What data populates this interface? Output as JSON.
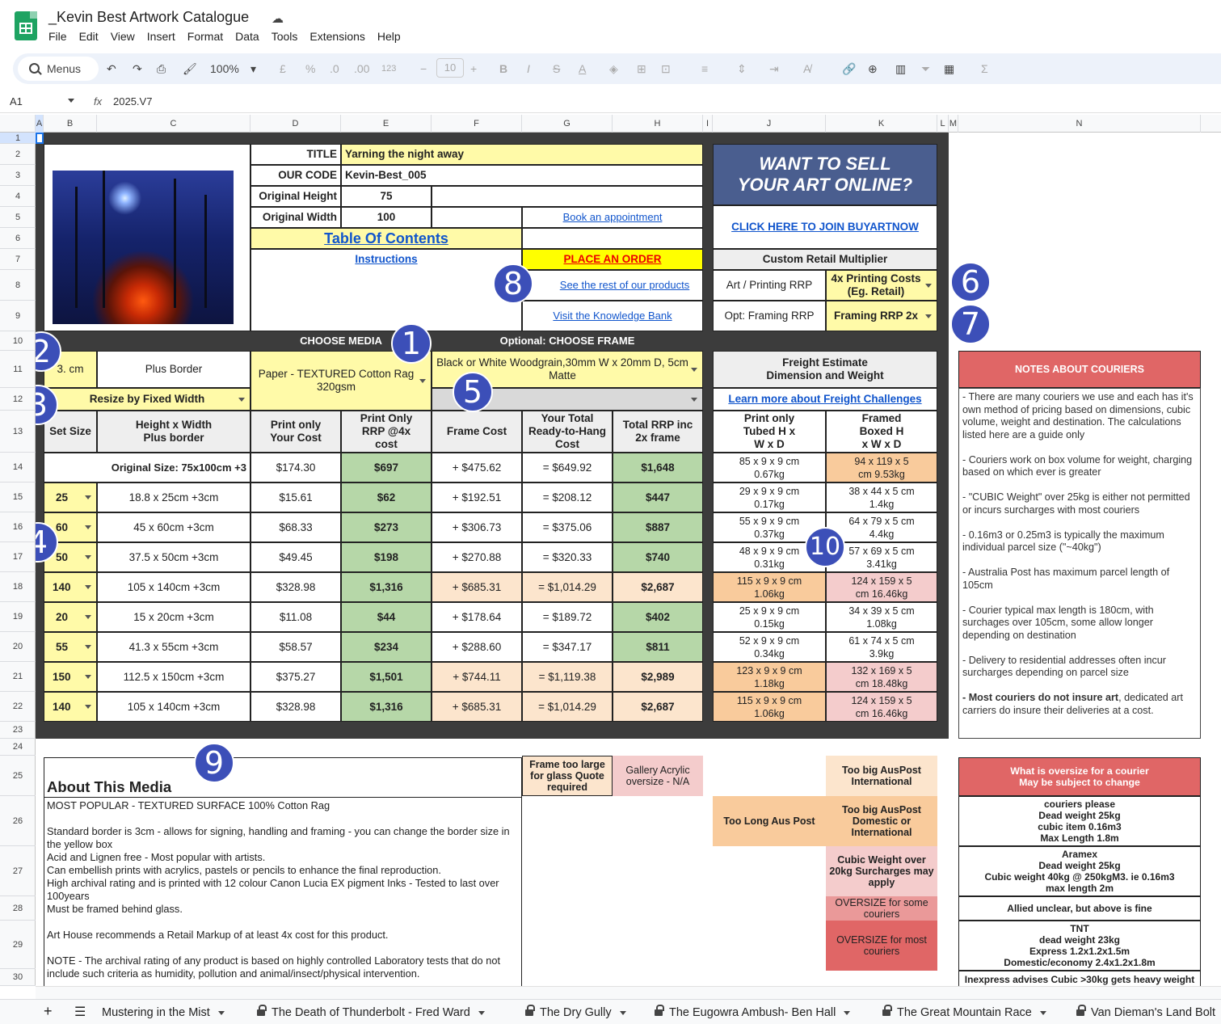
{
  "app": {
    "title": "_Kevin Best Artwork Catalogue",
    "menu": [
      "File",
      "Edit",
      "View",
      "Insert",
      "Format",
      "Data",
      "Tools",
      "Extensions",
      "Help"
    ],
    "icon": "google-sheets-icon"
  },
  "toolbar": {
    "menus": "Menus",
    "zoom": "100%",
    "pound": "£",
    "percent": "%",
    "dec_minus": ".0",
    "dec_plus": ".00",
    "num_format": "123",
    "font_size": "10"
  },
  "formula": {
    "cell": "A1",
    "fx": "fx",
    "value": "2025.V7"
  },
  "columns": [
    "A",
    "B",
    "C",
    "D",
    "E",
    "F",
    "G",
    "H",
    "I",
    "J",
    "K",
    "L",
    "M",
    "N"
  ],
  "rows": [
    "1",
    "2",
    "3",
    "4",
    "5",
    "6",
    "7",
    "8",
    "9",
    "10",
    "11",
    "12",
    "13",
    "14",
    "15",
    "16",
    "17",
    "18",
    "19",
    "20",
    "21",
    "22",
    "23",
    "24",
    "25",
    "26",
    "27",
    "28",
    "29",
    "30"
  ],
  "info": {
    "title_label": "TITLE",
    "title_value": "Yarning the night away",
    "code_label": "OUR CODE",
    "code_value": "Kevin-Best_005",
    "height_label": "Original Height",
    "height_value": "75",
    "width_label": "Original Width",
    "width_value": "100",
    "toc": "Table Of Contents",
    "instructions": "Instructions",
    "book": "Book an appointment",
    "order": "PLACE AN ORDER",
    "products": "See the rest of our products",
    "knowledge": "Visit the Knowledge Bank"
  },
  "promo": {
    "heading_1": "WANT TO SELL",
    "heading_2": "YOUR ART ONLINE?",
    "link": "CLICK HERE TO JOIN BUYARTNOW"
  },
  "multiplier": {
    "header": "Custom Retail Multiplier",
    "art_label": "Art / Printing RRP",
    "art_value": "4x Printing Costs (Eg. Retail)",
    "frame_label": "Opt: Framing RRP",
    "frame_value": "Framing RRP 2x"
  },
  "section": {
    "media": "CHOOSE MEDIA",
    "frame": "Optional: CHOOSE FRAME"
  },
  "options": {
    "border_value": "3. cm",
    "border_label": "Plus Border",
    "resize": "Resize by Fixed Width",
    "media": "Paper - TEXTURED Cotton Rag 320gsm",
    "frame": "Black or White Woodgrain,30mm W x 20mm D, 5cm Matte"
  },
  "freight": {
    "header": "Freight Estimate Dimension and Weight",
    "link": "Learn more about Freight Challenges",
    "tubed_header": "Print only Tubed H x W x D",
    "boxed_header": "Framed Boxed H x W x D"
  },
  "table_headers": {
    "set_size": "Set Size",
    "hw": "Height x Width Plus border",
    "print_cost": "Print only Your Cost",
    "print_rrp": "Print Only RRP @4x cost",
    "frame_cost": "Frame Cost",
    "total_cost": "Your Total Ready-to-Hang Cost",
    "total_rrp": "Total RRP inc 2x frame"
  },
  "original_row": {
    "label": "Original Size: 75x100cm +3",
    "print_cost": "$174.30",
    "print_rrp": "$697",
    "frame_cost": "+  $475.62",
    "total_cost": "=  $649.92",
    "total_rrp": "$1,648",
    "tubed": "85 x 9 x 9 cm 0.67kg",
    "boxed": "94 x 119 x 5 cm 9.53kg"
  },
  "size_rows": [
    {
      "set": "25",
      "hw": "18.8 x 25cm +3cm",
      "pc": "$15.61",
      "rrp": "$62",
      "fc": "+  $192.51",
      "tc": "=  $208.12",
      "trrp": "$447",
      "tubed": "29 x 9 x 9 cm 0.17kg",
      "boxed": "38 x 44 x 5 cm 1.4kg"
    },
    {
      "set": "60",
      "hw": "45 x 60cm +3cm",
      "pc": "$68.33",
      "rrp": "$273",
      "fc": "+  $306.73",
      "tc": "=  $375.06",
      "trrp": "$887",
      "tubed": "55 x 9 x 9 cm 0.37kg",
      "boxed": "64 x 79 x 5 cm 4.4kg"
    },
    {
      "set": "50",
      "hw": "37.5 x 50cm +3cm",
      "pc": "$49.45",
      "rrp": "$198",
      "fc": "+  $270.88",
      "tc": "=  $320.33",
      "trrp": "$740",
      "tubed": "48 x 9 x 9 cm 0.31kg",
      "boxed": "57 x 69 x 5 cm 3.41kg"
    },
    {
      "set": "140",
      "hw": "105 x 140cm +3cm",
      "pc": "$328.98",
      "rrp": "$1,316",
      "fc": "+  $685.31",
      "tc": "=  $1,014.29",
      "trrp": "$2,687",
      "tubed": "115 x 9 x 9 cm 1.06kg",
      "boxed": "124 x 159 x 5 cm 16.46kg"
    },
    {
      "set": "20",
      "hw": "15 x 20cm +3cm",
      "pc": "$11.08",
      "rrp": "$44",
      "fc": "+  $178.64",
      "tc": "=  $189.72",
      "trrp": "$402",
      "tubed": "25 x 9 x 9 cm 0.15kg",
      "boxed": "34 x 39 x 5 cm 1.08kg"
    },
    {
      "set": "55",
      "hw": "41.3 x 55cm +3cm",
      "pc": "$58.57",
      "rrp": "$234",
      "fc": "+  $288.60",
      "tc": "=  $347.17",
      "trrp": "$811",
      "tubed": "52 x 9 x 9 cm 0.34kg",
      "boxed": "61 x 74 x 5 cm 3.9kg"
    },
    {
      "set": "150",
      "hw": "112.5 x 150cm +3cm",
      "pc": "$375.27",
      "rrp": "$1,501",
      "fc": "+  $744.11",
      "tc": "=  $1,119.38",
      "trrp": "$2,989",
      "tubed": "123 x 9 x 9 cm 1.18kg",
      "boxed": "132 x 169 x 5 cm 18.48kg"
    },
    {
      "set": "140",
      "hw": "105 x 140cm +3cm",
      "pc": "$328.98",
      "rrp": "$1,316",
      "fc": "+  $685.31",
      "tc": "=  $1,014.29",
      "trrp": "$2,687",
      "tubed": "115 x 9 x 9 cm 1.06kg",
      "boxed": "124 x 159 x 5 cm 16.46kg"
    }
  ],
  "couriers": {
    "header": "NOTES ABOUT COURIERS",
    "notes": [
      "- There are many couriers we use and each has it's own method of pricing based on dimensions, cubic volume, weight and destination. The calculations listed here are a guide only",
      "- Couriers work on box volume for weight, charging based on which ever is greater",
      "- \"CUBIC Weight\" over 25kg is either not permitted or incurs surcharges with most couriers",
      "- 0.16m3 or 0.25m3 is typically the maximum individual parcel size (\"~40kg\")",
      "- Australia Post has maximum parcel length of 105cm",
      "- Courier typical max length is 180cm, with surchages over 105cm, some allow longer depending on destination",
      "- Delivery to residential addresses often incur surcharges depending on parcel size"
    ],
    "last_bold": "- Most couriers do not insure art",
    "last_rest": ", dedicated art carriers do insure their deliveries at a cost."
  },
  "legend": {
    "frame_large": "Frame too large for glass Quote required",
    "acrylic": "Gallery Acrylic oversize - N/A",
    "too_long": "Too Long Aus Post",
    "too_big_intl": "Too big AusPost International",
    "too_big_dom": "Too big AusPost Domestic or International",
    "cubic": "Cubic Weight over 20kg Surcharges may apply",
    "oversize_some": "OVERSIZE for some couriers",
    "oversize_most": "OVERSIZE for most couriers"
  },
  "about": {
    "heading": "About This Media",
    "lines": [
      "MOST POPULAR - TEXTURED SURFACE 100% Cotton Rag",
      "",
      "Standard border is 3cm - allows for signing, handling and framing - you can change the border size in the yellow box",
      "Acid and Lignen free - Most popular with artists.",
      "Can embellish prints with acrylics, pastels or pencils to enhance the final reproduction.",
      "High archival rating and is printed with 12 colour Canon Lucia EX pigment Inks - Tested to last over 100years",
      "Must be framed behind glass.",
      "",
      "Art House recommends a Retail Markup of at least 4x cost for this product.",
      "",
      "NOTE - The archival rating of any product is based on highly controlled Laboratory tests that do not include such criteria as humidity, pollution and animal/insect/physical intervention."
    ]
  },
  "oversize": {
    "header": "What is oversize for a courier May be subject to change",
    "items": [
      "couriers please\nDead weight 25kg\ncubic item 0.16m3\nMax Length 1.8m",
      "Aramex\nDead weight 25kg\nCubic weight 40kg @ 250kgM3. ie 0.16m3\nmax length 2m",
      "Allied unclear, but above is fine",
      "TNT\ndead weight 23kg\nExpress 1.2x1.2x1.5m\nDomestic/economy 2.4x1.2x1.8m",
      "Inexpress advises Cubic >30kg gets heavy weight"
    ]
  },
  "badges": [
    "1",
    "2",
    "3",
    "4",
    "5",
    "6",
    "7",
    "8",
    "9",
    "10"
  ],
  "sheets": [
    "Mustering in the Mist",
    "The Death of Thunderbolt - Fred Ward",
    "The Dry Gully",
    "The Eugowra Ambush- Ben Hall",
    "The Great Mountain Race",
    "Van Dieman's Land Bolt"
  ],
  "colors": {
    "promo_bg": "#4a5e8f",
    "header_yellow": "#fffaa8",
    "rrp_green": "#b6d7a8",
    "orange": "#f9cb9c",
    "pink": "#f4cccc",
    "courier_red": "#e06666",
    "badge": "#3c4fb8"
  }
}
